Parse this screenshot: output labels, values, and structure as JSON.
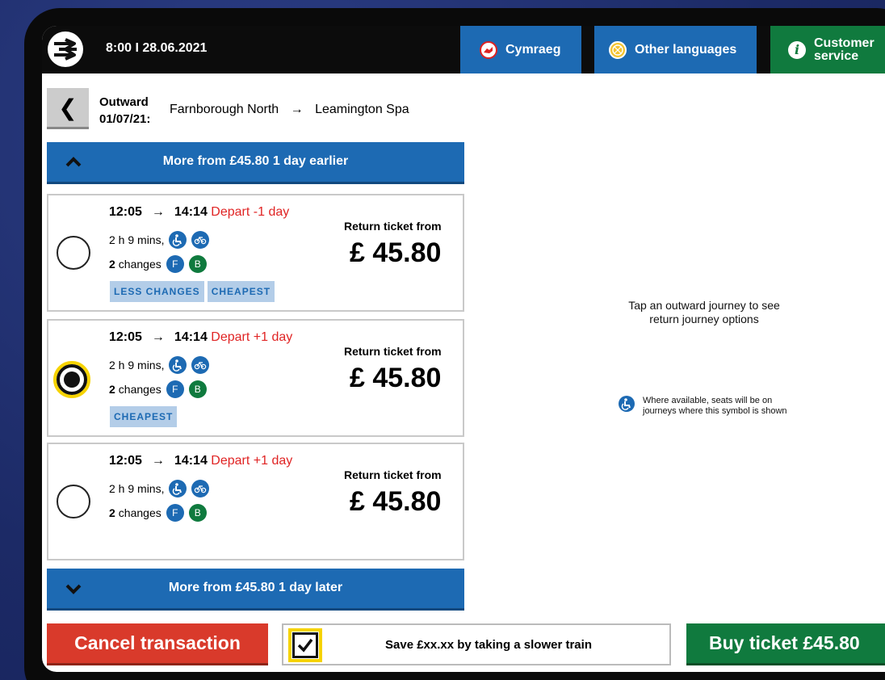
{
  "topbar": {
    "datetime": "8:00 I 28.06.2021",
    "cymraeg_label": "Cymraeg",
    "other_languages_label": "Other languages",
    "customer_service_line1": "Customer",
    "customer_service_line2": "service"
  },
  "journey": {
    "outward_label": "Outward",
    "outward_date": "01/07/21:",
    "from": "Farnborough North",
    "arrow": "→",
    "to": "Leamington Spa"
  },
  "more_earlier_label": "More from £45.80 1 day earlier",
  "more_later_label": "More from £45.80 1 day later",
  "results": [
    {
      "depart": "12:05",
      "arrow": "→",
      "arrive": "14:14",
      "depart_note": "Depart -1 day",
      "duration": "2 h 9 mins,",
      "changes_count": "2",
      "changes_label": "changes",
      "operators": [
        "F",
        "B"
      ],
      "tags": [
        "LESS CHANGES",
        "CHEAPEST"
      ],
      "price_label": "Return ticket from",
      "price": "£ 45.80",
      "selected": false
    },
    {
      "depart": "12:05",
      "arrow": "→",
      "arrive": "14:14",
      "depart_note": "Depart +1 day",
      "duration": "2 h 9 mins,",
      "changes_count": "2",
      "changes_label": "changes",
      "operators": [
        "F",
        "B"
      ],
      "tags": [
        "CHEAPEST"
      ],
      "price_label": "Return ticket from",
      "price": "£ 45.80",
      "selected": true
    },
    {
      "depart": "12:05",
      "arrow": "→",
      "arrive": "14:14",
      "depart_note": "Depart +1 day",
      "duration": "2 h 9 mins,",
      "changes_count": "2",
      "changes_label": "changes",
      "operators": [
        "F",
        "B"
      ],
      "tags": [],
      "price_label": "Return ticket from",
      "price": "£ 45.80",
      "selected": false
    }
  ],
  "right_panel": {
    "hint_line1": "Tap an outward journey to see",
    "hint_line2": "return journey options",
    "seat_note_line1": "Where available, seats will be on",
    "seat_note_line2": "journeys where this symbol is shown"
  },
  "bottom": {
    "cancel_label": "Cancel transaction",
    "save_label": "Save £xx.xx by taking a slower train",
    "save_checked": true,
    "buy_label": "Buy ticket £45.80"
  },
  "colors": {
    "primary_blue": "#1d6ab3",
    "green": "#107a3e",
    "red": "#d93a2b",
    "depart_red": "#e02424",
    "focus_yellow": "#f6d300",
    "tag_bg": "#b3cde8"
  }
}
